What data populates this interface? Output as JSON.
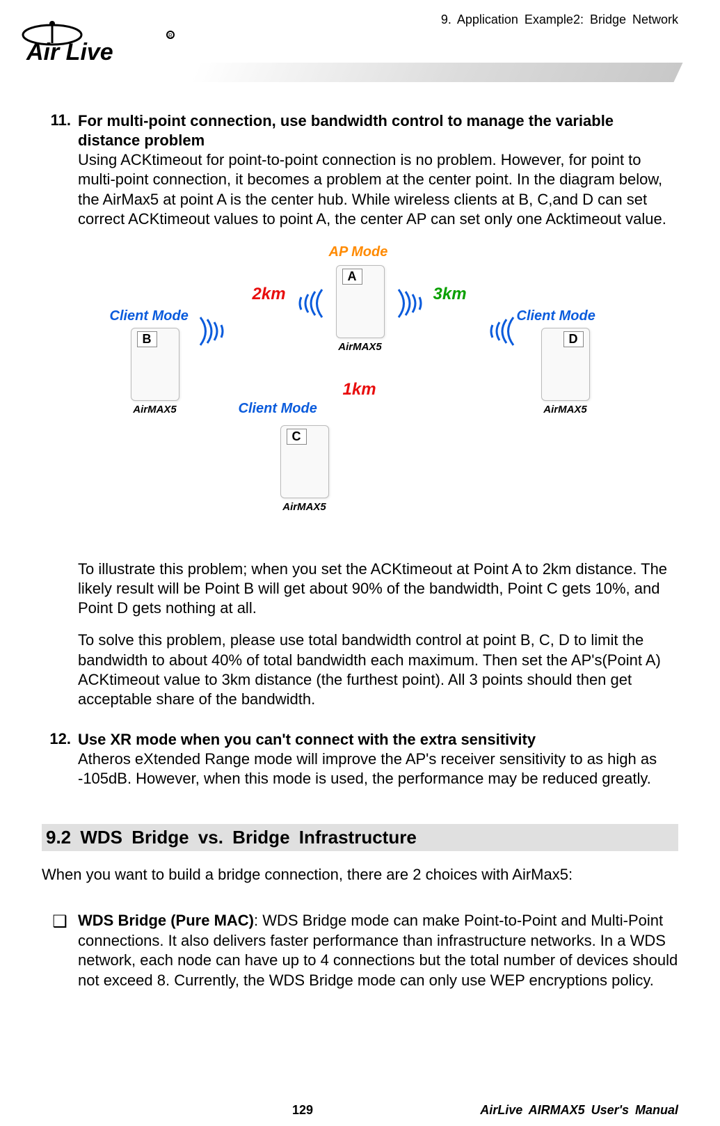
{
  "header": {
    "chapter": "9. Application Example2: Bridge Network"
  },
  "logo": {
    "line1": "Air Live"
  },
  "items": {
    "n11": {
      "num": "11.",
      "heading": "For multi-point connection, use bandwidth control to manage the variable distance problem",
      "para1": "Using ACKtimeout for point-to-point connection is no problem.    However, for point to multi-point connection, it becomes a problem at the center point.    In the diagram below, the AirMax5 at point A is the center hub.    While wireless clients at B, C,and D can set correct ACKtimeout values to point A, the center AP can set only one Acktimeout value.",
      "para2": "To illustrate this problem; when you set the ACKtimeout at Point A to 2km distance. The likely result will be Point B will get about 90% of the bandwidth, Point C gets 10%, and Point D gets nothing at all.",
      "para3": "To solve this problem, please use total bandwidth control at point B, C, D to limit the bandwidth to about 40% of total bandwidth each maximum. Then set the AP's(Point A) ACKtimeout value to 3km distance (the furthest point).    All 3 points should then get acceptable share of the bandwidth."
    },
    "n12": {
      "num": "12.",
      "heading": "Use XR mode when you can't connect with the extra sensitivity",
      "para1": "Atheros eXtended Range mode will improve the AP's receiver sensitivity to as high as -105dB.    However, when this mode is used, the performance may be reduced greatly."
    }
  },
  "diagram": {
    "ap_mode": "AP Mode",
    "client_mode": "Client Mode",
    "dev_caption": "AirMAX5",
    "dist2": "2km",
    "dist3": "3km",
    "dist1": "1km",
    "A": "A",
    "B": "B",
    "C": "C",
    "D": "D"
  },
  "section92": {
    "title": "9.2 WDS Bridge vs. Bridge Infrastructure",
    "intro": "When you want to build a bridge connection, there are 2 choices with AirMax5:",
    "bullet1_label": "WDS Bridge (Pure MAC)",
    "bullet1_body": ":    WDS Bridge mode can make Point-to-Point and Multi-Point connections.    It also delivers faster performance than infrastructure networks.    In a WDS network, each node can have up to 4 connections but the total number of devices should not exceed 8.    Currently, the WDS Bridge mode can only use WEP encryptions policy."
  },
  "footer": {
    "page": "129",
    "manual": "AirLive AIRMAX5 User's Manual"
  }
}
